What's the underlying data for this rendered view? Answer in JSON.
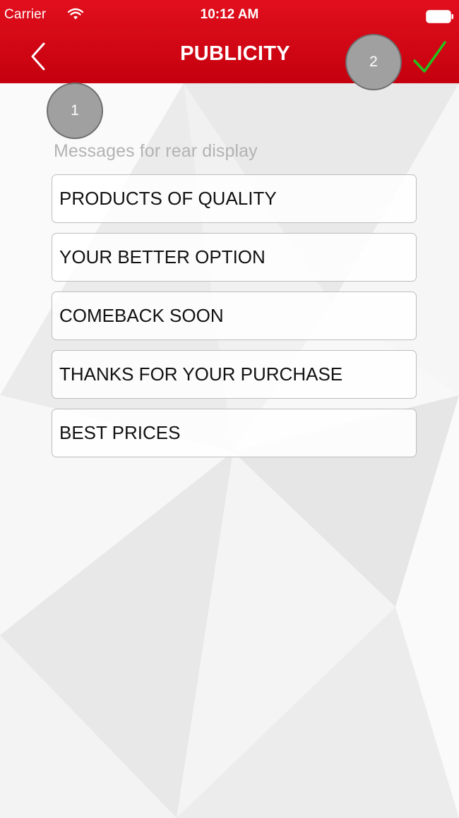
{
  "status_bar": {
    "carrier": "Carrier",
    "time": "10:12 AM",
    "icons": [
      "wifi-icon",
      "battery-icon"
    ]
  },
  "header": {
    "title": "PUBLICITY",
    "back_icon": "chevron-left-icon",
    "save_icon": "checkmark-icon",
    "background_color": "#d50816",
    "checkmark_color": "#22c41e"
  },
  "annotations": {
    "marker_1": "1",
    "marker_2": "2"
  },
  "messages": {
    "label": "Messages for rear display",
    "items": [
      "PRODUCTS OF QUALITY",
      "YOUR BETTER OPTION",
      "COMEBACK SOON",
      "THANKS FOR YOUR PURCHASE",
      "BEST PRICES"
    ]
  }
}
